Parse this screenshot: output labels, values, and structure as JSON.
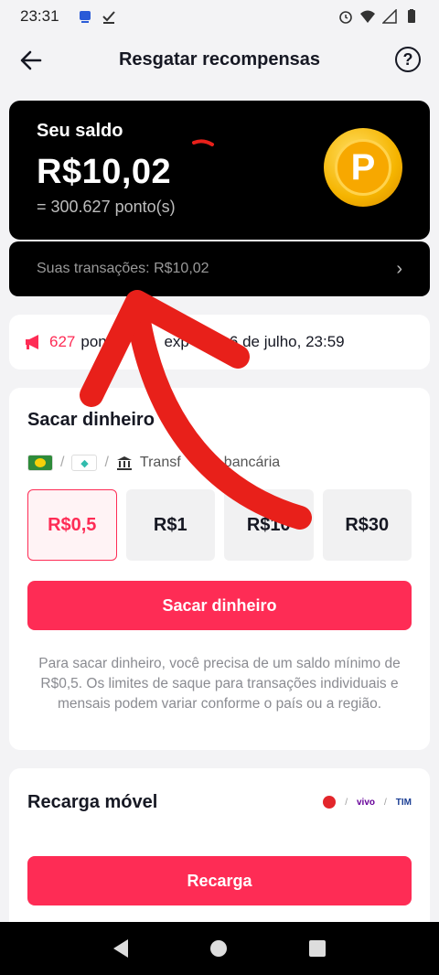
{
  "status_bar": {
    "time": "23:31"
  },
  "header": {
    "title": "Resgatar recompensas",
    "help": "?"
  },
  "balance": {
    "label": "Seu saldo",
    "amount": "R$10,02",
    "points": "= 300.627 ponto(s)",
    "coin_letter": "P"
  },
  "transactions": {
    "label": "Suas transações: R$10,02",
    "chevron": "›"
  },
  "notice": {
    "points": "627",
    "text_before": "pont",
    "text_middle": "exp",
    "text_after": "6 de julho, 23:59"
  },
  "withdraw": {
    "title": "Sacar dinheiro",
    "method_label": "Transf   ncia bancária",
    "options": [
      {
        "label": "R$0,5",
        "selected": true
      },
      {
        "label": "R$1",
        "selected": false
      },
      {
        "label": "R$10",
        "selected": false
      },
      {
        "label": "R$30",
        "selected": false
      }
    ],
    "button": "Sacar dinheiro",
    "hint": "Para sacar dinheiro, você precisa de um saldo mínimo de R$0,5. Os limites de saque para transações individuais e mensais podem variar conforme o país ou a região."
  },
  "recharge": {
    "title": "Recarga móvel",
    "carriers": [
      "vivo",
      "TIM"
    ],
    "button": "Recarga"
  },
  "colors": {
    "accent": "#fe2c55",
    "annotation": "#e8201a"
  }
}
